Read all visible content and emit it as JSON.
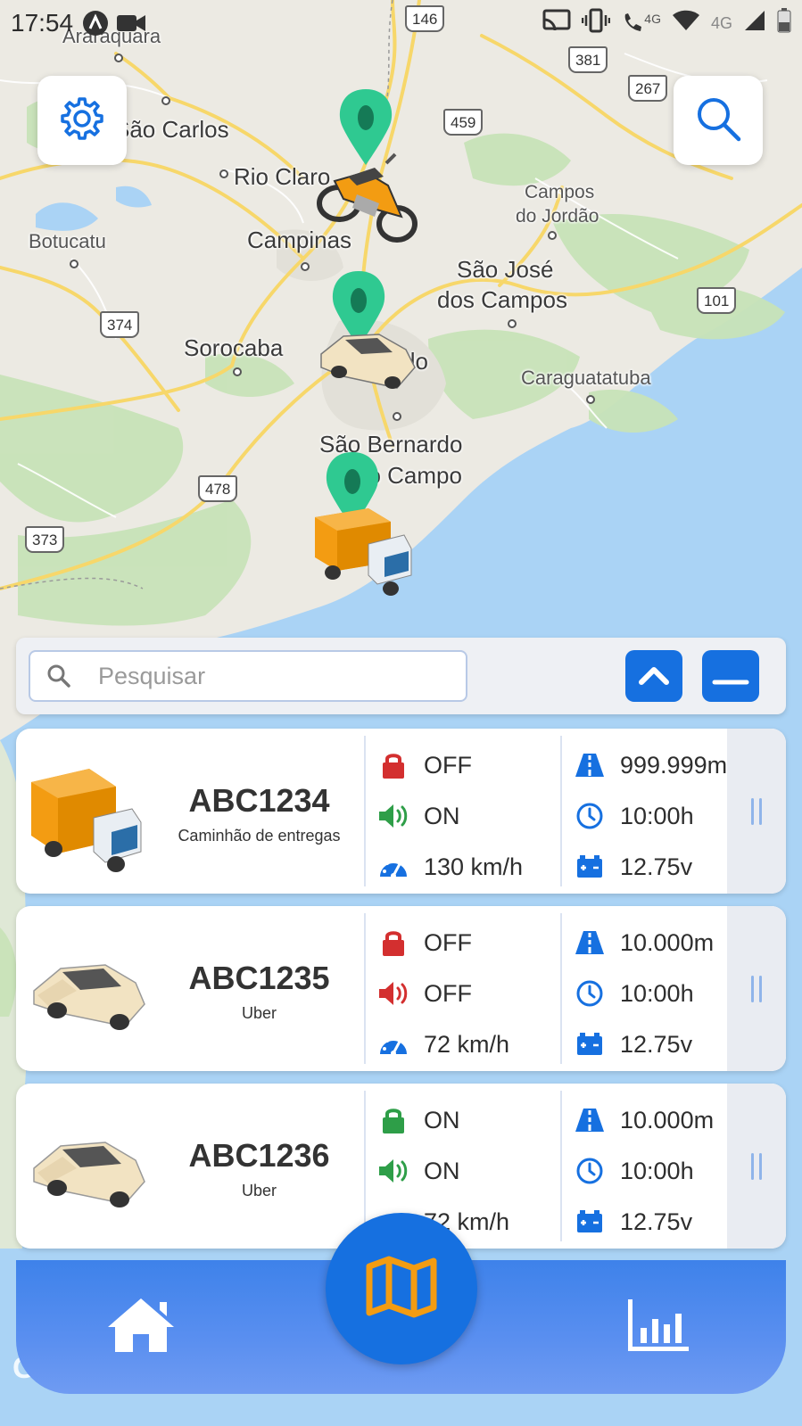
{
  "status_bar": {
    "time": "17:54",
    "network_1": "4G",
    "network_2": "4G",
    "icons": [
      "app-a-icon",
      "video-icon",
      "cast-icon",
      "vibrate-icon",
      "wifi-call-icon",
      "wifi-icon",
      "signal-icon",
      "battery-icon"
    ]
  },
  "map": {
    "cities": {
      "araraquara": "Araraquara",
      "sao_carlos": "São Carlos",
      "rio_claro": "Rio Claro",
      "botucatu": "Botucatu",
      "campinas": "Campinas",
      "campos_jordao_1": "Campos",
      "campos_jordao_2": "do Jordão",
      "sjc_1": "São José",
      "sjc_2": "dos Campos",
      "sorocaba": "Sorocaba",
      "sao_paulo": "São Paulo",
      "caraguatatuba": "Caraguatatuba",
      "sbc_1": "São Bernardo",
      "sbc_2": "do Campo"
    },
    "highways": {
      "h146": "146",
      "h381": "381",
      "h267": "267",
      "h459": "459",
      "h101": "101",
      "h374": "374",
      "h478": "478",
      "h373": "373"
    },
    "google_logo": "Google"
  },
  "buttons": {
    "settings_icon": "gear-icon",
    "search_icon": "search-icon"
  },
  "search": {
    "placeholder": "Pesquisar",
    "value": ""
  },
  "vehicles": [
    {
      "plate": "ABC1234",
      "description": "Caminhão de entregas",
      "type": "truck",
      "lock": "OFF",
      "lock_color": "#d32f2f",
      "sound": "ON",
      "sound_color": "#2e9e48",
      "speed": "130 km/h",
      "odometer": "999.999m",
      "time": "10:00h",
      "voltage": "12.75v"
    },
    {
      "plate": "ABC1235",
      "description": "Uber",
      "type": "car",
      "lock": "OFF",
      "lock_color": "#d32f2f",
      "sound": "OFF",
      "sound_color": "#d32f2f",
      "speed": "72 km/h",
      "odometer": "10.000m",
      "time": "10:00h",
      "voltage": "12.75v"
    },
    {
      "plate": "ABC1236",
      "description": "Uber",
      "type": "car",
      "lock": "ON",
      "lock_color": "#2e9e48",
      "sound": "ON",
      "sound_color": "#2e9e48",
      "speed": "72 km/h",
      "odometer": "10.000m",
      "time": "10:00h",
      "voltage": "12.75v"
    }
  ],
  "nav": {
    "home_icon": "home-icon",
    "map_icon": "map-icon",
    "reports_icon": "bar-chart-icon"
  },
  "colors": {
    "primary": "#1670e0",
    "marker": "#2fc991",
    "accent_orange": "#f39c12"
  }
}
